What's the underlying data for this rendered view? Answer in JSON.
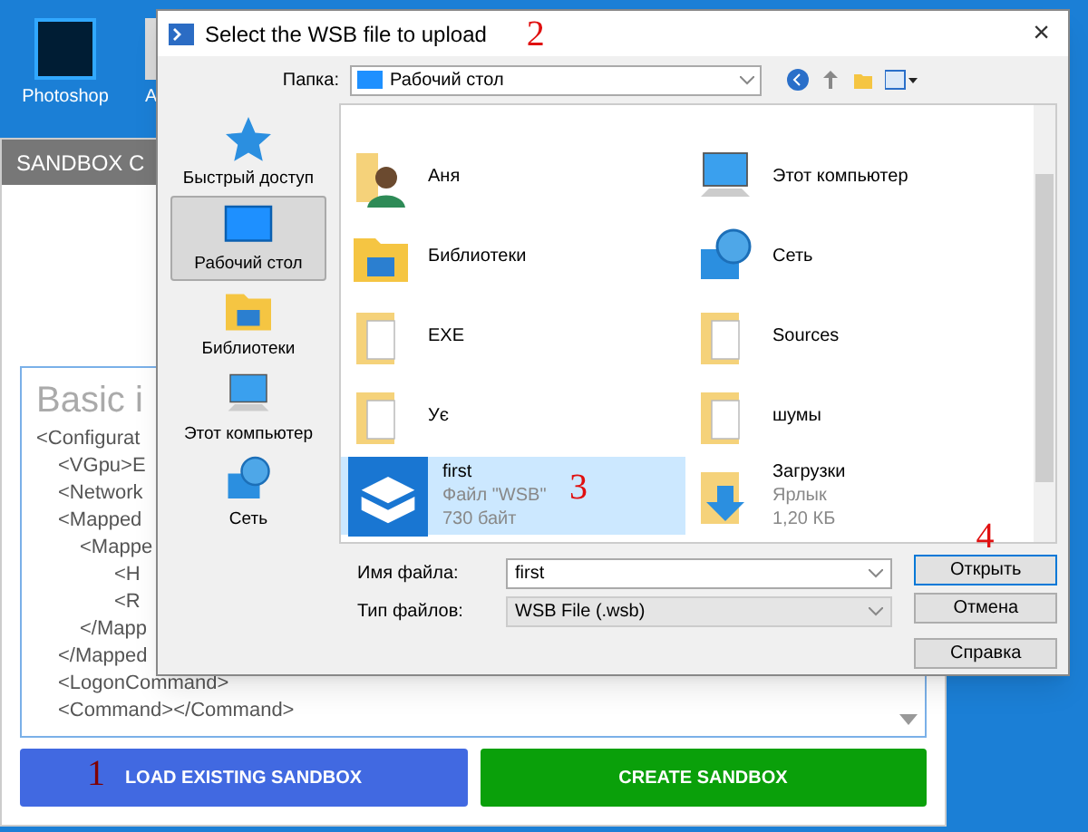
{
  "desktop_icons": [
    {
      "label": "Photoshop"
    },
    {
      "label": "A"
    }
  ],
  "sandbox_window": {
    "title": "SANDBOX C",
    "editor": {
      "heading": "Basic i",
      "lines": [
        {
          "text": "<Configurat",
          "children": [
            {
              "text": "<VGpu>E"
            },
            {
              "text": "<Network"
            },
            {
              "text": "<Mapped",
              "children": [
                {
                  "text": "<Mappe",
                  "children": [
                    {
                      "text": "<H"
                    },
                    {
                      "text": "<R"
                    }
                  ]
                },
                {
                  "text": "</Mapp"
                }
              ]
            },
            {
              "text": "</Mapped"
            },
            {
              "text": "<LogonCommand>"
            },
            {
              "text": "<Command></Command>"
            }
          ]
        }
      ]
    },
    "buttons": [
      {
        "label": "LOAD EXISTING SANDBOX",
        "kind": "load"
      },
      {
        "label": "CREATE SANDBOX",
        "kind": "create"
      }
    ]
  },
  "dialog": {
    "title": "Select the WSB file to upload",
    "close_label": "×",
    "folder_label": "Папка:",
    "folder_value": "Рабочий стол",
    "places": [
      {
        "label": "Быстрый доступ",
        "kind": "star",
        "selected": false
      },
      {
        "label": "Рабочий стол",
        "kind": "desktop",
        "selected": true
      },
      {
        "label": "Библиотеки",
        "kind": "library",
        "selected": false
      },
      {
        "label": "Этот компьютер",
        "kind": "computer",
        "selected": false
      },
      {
        "label": "Сеть",
        "kind": "network",
        "selected": false
      }
    ],
    "files": [
      {
        "name": "Аня",
        "kind": "user",
        "selected": false
      },
      {
        "name": "Этот компьютер",
        "kind": "computer",
        "selected": false
      },
      {
        "name": "Библиотеки",
        "kind": "library",
        "selected": false
      },
      {
        "name": "Сеть",
        "kind": "network",
        "selected": false
      },
      {
        "name": "EXE",
        "kind": "folder",
        "selected": false
      },
      {
        "name": "Sources",
        "kind": "folder",
        "selected": false
      },
      {
        "name": "Ує",
        "kind": "folder",
        "selected": false
      },
      {
        "name": "шумы",
        "kind": "folder",
        "selected": false
      },
      {
        "name": "first",
        "kind": "wsb",
        "selected": true,
        "type": "Файл \"WSB\"",
        "size": "730 байт"
      },
      {
        "name": "Загрузки",
        "kind": "shortcut",
        "selected": false,
        "type": "Ярлык",
        "size": "1,20 КБ"
      }
    ],
    "filename_label": "Имя файла:",
    "filename_value": "first",
    "filetype_label": "Тип файлов:",
    "filetype_value": "WSB File (.wsb)",
    "buttons": [
      {
        "label": "Открыть",
        "selected": true
      },
      {
        "label": "Отмена",
        "selected": false
      },
      {
        "label": "Справка",
        "selected": false
      }
    ]
  },
  "annotations": [
    {
      "text": "1"
    },
    {
      "text": "2"
    },
    {
      "text": "3"
    },
    {
      "text": "4"
    }
  ]
}
